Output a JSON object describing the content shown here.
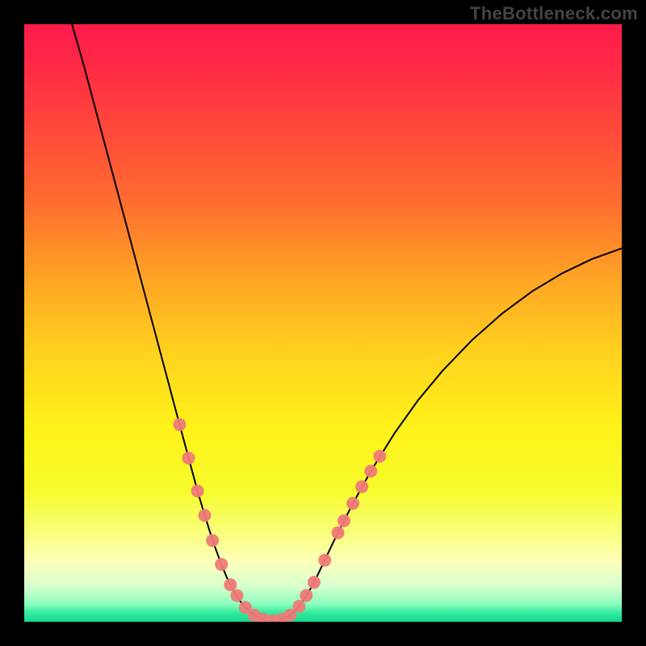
{
  "watermark": "TheBottleneck.com",
  "chart_data": {
    "type": "line",
    "title": "",
    "xlabel": "",
    "ylabel": "",
    "xlim": [
      0,
      100
    ],
    "ylim": [
      0,
      100
    ],
    "plot_background": {
      "gradient_stops": [
        {
          "offset": 0.0,
          "color": "#ff1a4b"
        },
        {
          "offset": 0.07,
          "color": "#ff2a46"
        },
        {
          "offset": 0.18,
          "color": "#ff4a3a"
        },
        {
          "offset": 0.3,
          "color": "#ff6d2f"
        },
        {
          "offset": 0.42,
          "color": "#ffa226"
        },
        {
          "offset": 0.55,
          "color": "#ffd21e"
        },
        {
          "offset": 0.68,
          "color": "#fff31a"
        },
        {
          "offset": 0.78,
          "color": "#f6fb2b"
        },
        {
          "offset": 0.85,
          "color": "#f9ff7a"
        },
        {
          "offset": 0.9,
          "color": "#fcffb9"
        },
        {
          "offset": 0.94,
          "color": "#d8ffcf"
        },
        {
          "offset": 0.97,
          "color": "#8cffbe"
        },
        {
          "offset": 0.985,
          "color": "#34eaa0"
        },
        {
          "offset": 1.0,
          "color": "#15d68a"
        }
      ]
    },
    "series": [
      {
        "name": "bottleneck-curve",
        "color": "#000000",
        "stroke_width": 2,
        "x": [
          8,
          10,
          12,
          14,
          16,
          18,
          20,
          22,
          24,
          26,
          27,
          28,
          29,
          30,
          31,
          32,
          33,
          34,
          35,
          36,
          37,
          38,
          39,
          40,
          41,
          42,
          43,
          44,
          45,
          46,
          47,
          48,
          49,
          50,
          52,
          55,
          58,
          62,
          66,
          70,
          75,
          80,
          85,
          90,
          95,
          100
        ],
        "y": [
          100,
          93,
          85.5,
          78,
          70.5,
          63,
          55.5,
          48,
          40.5,
          33,
          29.3,
          25.6,
          21.9,
          18.5,
          15.3,
          12.3,
          9.6,
          7.2,
          5.2,
          3.6,
          2.4,
          1.5,
          0.8,
          0.4,
          0.2,
          0.2,
          0.4,
          0.8,
          1.5,
          2.6,
          4.0,
          5.7,
          7.6,
          9.7,
          13.9,
          19.8,
          25.2,
          31.6,
          37.2,
          42.0,
          47.2,
          51.6,
          55.3,
          58.3,
          60.7,
          62.5
        ]
      }
    ],
    "markers": {
      "color": "#ef7a78",
      "radius": 8,
      "opacity": 0.95,
      "points": [
        {
          "x": 26.0,
          "y": 33.0
        },
        {
          "x": 27.5,
          "y": 27.4
        },
        {
          "x": 29.0,
          "y": 21.9
        },
        {
          "x": 30.2,
          "y": 17.8
        },
        {
          "x": 31.5,
          "y": 13.6
        },
        {
          "x": 33.0,
          "y": 9.6
        },
        {
          "x": 34.5,
          "y": 6.2
        },
        {
          "x": 35.6,
          "y": 4.4
        },
        {
          "x": 37.0,
          "y": 2.4
        },
        {
          "x": 38.5,
          "y": 1.1
        },
        {
          "x": 40.0,
          "y": 0.4
        },
        {
          "x": 41.5,
          "y": 0.2
        },
        {
          "x": 43.0,
          "y": 0.4
        },
        {
          "x": 44.5,
          "y": 1.1
        },
        {
          "x": 46.0,
          "y": 2.6
        },
        {
          "x": 47.2,
          "y": 4.4
        },
        {
          "x": 48.5,
          "y": 6.6
        },
        {
          "x": 50.3,
          "y": 10.3
        },
        {
          "x": 52.5,
          "y": 14.9
        },
        {
          "x": 53.5,
          "y": 16.9
        },
        {
          "x": 55.0,
          "y": 19.8
        },
        {
          "x": 56.5,
          "y": 22.6
        },
        {
          "x": 58.0,
          "y": 25.2
        },
        {
          "x": 59.5,
          "y": 27.7
        }
      ]
    }
  }
}
